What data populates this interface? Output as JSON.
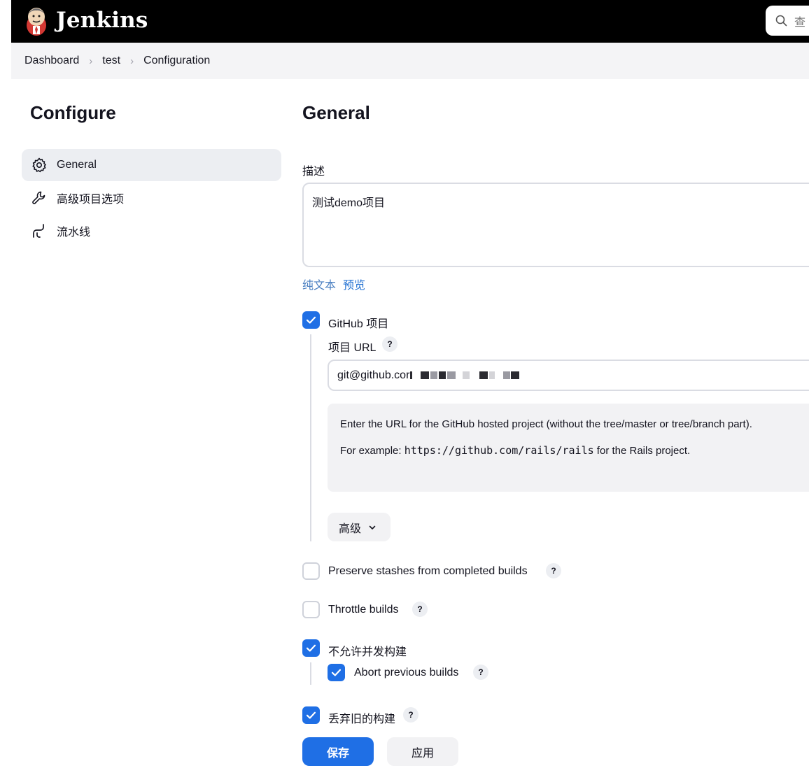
{
  "header": {
    "brand": "Jenkins",
    "search_placeholder": "查"
  },
  "breadcrumb": [
    "Dashboard",
    "test",
    "Configuration"
  ],
  "sidebar": {
    "title": "Configure",
    "items": [
      {
        "label": "General",
        "icon": "gear-icon",
        "active": true
      },
      {
        "label": "高级项目选项",
        "icon": "wrench-icon",
        "active": false
      },
      {
        "label": "流水线",
        "icon": "pipeline-icon",
        "active": false
      }
    ]
  },
  "main": {
    "title": "General",
    "description_label": "描述",
    "description_value": "测试demo项目",
    "format_links": {
      "plain": "纯文本",
      "preview": "预览"
    },
    "github": {
      "checkbox_label": "GitHub 项目",
      "checked": true,
      "url_label": "项目 URL",
      "url_value": "git@github.cor",
      "help_line1": "Enter the URL for the GitHub hosted project (without the tree/master or tree/branch part).",
      "help_line2_prefix": "For example: ",
      "help_line2_code": "https://github.com/rails/rails",
      "help_line2_suffix": " for the Rails project.",
      "advanced_label": "高级"
    },
    "options": [
      {
        "label": "Preserve stashes from completed builds",
        "checked": false,
        "help": true
      },
      {
        "label": "Throttle builds",
        "checked": false,
        "help": true
      },
      {
        "label": "不允许并发构建",
        "checked": true,
        "help": false
      },
      {
        "label": "Abort previous builds",
        "checked": true,
        "help": true
      },
      {
        "label": "丢弃旧的构建",
        "checked": true,
        "help": true
      }
    ],
    "help_glyph": "?"
  },
  "footer": {
    "save_label": "保存",
    "apply_label": "应用"
  },
  "colors": {
    "accent": "#1f6fe5",
    "header_bg": "#000000",
    "breadcrumb_bg": "#f4f4f6"
  }
}
